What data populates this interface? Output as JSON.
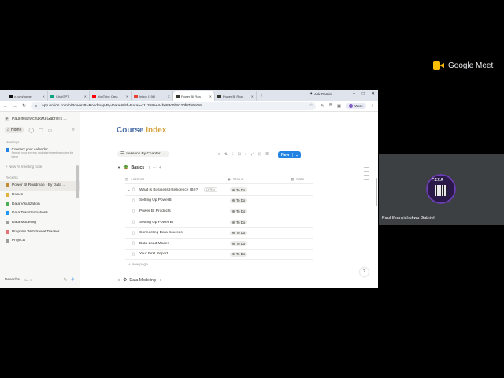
{
  "meet": {
    "brand": "Google Meet",
    "participant_name": "Paul Ifeanyichukwu Gabriel",
    "avatar_brand": "FSXA"
  },
  "browser": {
    "tabs": [
      {
        "label": "x.com/home",
        "color": "#111111",
        "active": false
      },
      {
        "label": "ChatGPT",
        "color": "#10a37f",
        "active": false
      },
      {
        "label": "YouTube Crea",
        "color": "#ff0000",
        "active": false
      },
      {
        "label": "Inbox (198)",
        "color": "#ea4335",
        "active": false
      },
      {
        "label": "Power BI Roa",
        "color": "#37352f",
        "active": true
      },
      {
        "label": "Power BI Roa",
        "color": "#37352f",
        "active": false
      }
    ],
    "new_tab": "+",
    "gemini_label": "Ask Gemini",
    "url": "app.notion.com/p/Power-BI-Roadmap-By-Data-With-Baraa-d11358ae44b683c0b9120f07b9b08a",
    "profile_label": "Work"
  },
  "sidebar": {
    "workspace": "Paul Ifeanyichukwu Gabriel's ...",
    "home_label": "Home",
    "meetings_heading": "Meetings",
    "calendar_title": "Connect your calendar",
    "calendar_sub": "See all your events and start meeting notes for them",
    "new_meeting": "New AI meeting note",
    "recents_heading": "Recents",
    "recents": [
      {
        "label": "Power BI Roadmap - By Data ...",
        "color": "#c08a2e",
        "selected": true
      },
      {
        "label": "Basics",
        "color": "#e2b33c",
        "selected": false
      },
      {
        "label": "Data Visulization",
        "color": "#4caf50",
        "selected": false
      },
      {
        "label": "Data Transformations",
        "color": "#2196f3",
        "selected": false
      },
      {
        "label": "Data Modeling",
        "color": "#9e9e9e",
        "selected": false
      },
      {
        "label": "Propfirm Withdrawal Tracker",
        "color": "#e57373",
        "selected": false
      },
      {
        "label": "Projects",
        "color": "#9e9e9e",
        "selected": false
      }
    ],
    "new_chat": "New chat",
    "new_chat_kbd": "Ctrl+0"
  },
  "main": {
    "title_prefix": "Course ",
    "title_highlight": "Index",
    "view_label": "Lessons By Chapter",
    "new_button": "New",
    "group1": {
      "name": "Basics",
      "count": "7"
    },
    "col_lessons": "Lessons",
    "col_status": "Status",
    "col_date": "Date",
    "open_label": "OPEN",
    "rows": [
      {
        "name": "What is Business Intelligence (BI)?",
        "status": "To Do"
      },
      {
        "name": "Setting Up PowerBI",
        "status": "To Do"
      },
      {
        "name": "Power BI Products",
        "status": "To Do"
      },
      {
        "name": "Setting Up Power BI",
        "status": "To Do"
      },
      {
        "name": "Connecting Data Sources",
        "status": "To Do"
      },
      {
        "name": "Data Load Modes",
        "status": "To Do"
      },
      {
        "name": "Your First Report",
        "status": "To Do"
      }
    ],
    "new_page": "New page",
    "group2": {
      "name": "Data Modeling",
      "count": "8"
    },
    "help": "?"
  }
}
